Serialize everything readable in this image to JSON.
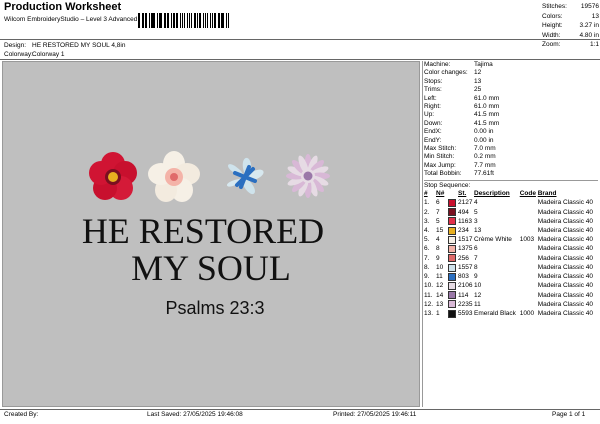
{
  "header": {
    "title": "Production Worksheet",
    "subtitle": "Wilcom EmbroideryStudio – Level 3 Advanced",
    "design_label": "Design:",
    "design_value": "HE RESTORED MY SOUL 4,8in",
    "colorway_label": "Colorway:",
    "colorway_value": "Colorway 1"
  },
  "summary": [
    {
      "k": "Stitches:",
      "v": "19576"
    },
    {
      "k": "Colors:",
      "v": "13"
    },
    {
      "k": "Height:",
      "v": "3.27 in"
    },
    {
      "k": "Width:",
      "v": "4.80 in"
    },
    {
      "k": "Zoom:",
      "v": "1:1"
    }
  ],
  "params": [
    {
      "k": "Machine:",
      "v": "Tajima"
    },
    {
      "k": "Color changes:",
      "v": "12"
    },
    {
      "k": "Stops:",
      "v": "13"
    },
    {
      "k": "Trims:",
      "v": "25"
    },
    {
      "k": "Left:",
      "v": "61.0 mm"
    },
    {
      "k": "Right:",
      "v": "61.0 mm"
    },
    {
      "k": "Up:",
      "v": "41.5 mm"
    },
    {
      "k": "Down:",
      "v": "41.5 mm"
    },
    {
      "k": "EndX:",
      "v": "0.00 in"
    },
    {
      "k": "EndY:",
      "v": "0.00 in"
    },
    {
      "k": "Max Stitch:",
      "v": "7.0 mm"
    },
    {
      "k": "Min Stitch:",
      "v": "0.2 mm"
    },
    {
      "k": "Max Jump:",
      "v": "7.7 mm"
    },
    {
      "k": "Total Bobbin:",
      "v": "77.61ft"
    }
  ],
  "sequence": {
    "heading": "Stop Sequence:",
    "columns": [
      "#",
      "N#",
      "St.",
      "Description",
      "Code",
      "Brand"
    ],
    "rows": [
      {
        "n": "1.",
        "needle": "6",
        "color": "#c8102e",
        "code": "2127",
        "desc": "4",
        "ccode": "",
        "brand": "Madeira Classic 40"
      },
      {
        "n": "2.",
        "needle": "7",
        "color": "#7a1020",
        "code": "494",
        "desc": "5",
        "ccode": "",
        "brand": "Madeira Classic 40"
      },
      {
        "n": "3.",
        "needle": "5",
        "color": "#e0304a",
        "code": "1163",
        "desc": "3",
        "ccode": "",
        "brand": "Madeira Classic 40"
      },
      {
        "n": "4.",
        "needle": "15",
        "color": "#e8b020",
        "code": "234",
        "desc": "13",
        "ccode": "",
        "brand": "Madeira Classic 40"
      },
      {
        "n": "5.",
        "needle": "4",
        "color": "#f6f0e6",
        "code": "1517",
        "desc": "Crème White",
        "ccode": "1003",
        "brand": "Madeira Classic 40"
      },
      {
        "n": "6.",
        "needle": "8",
        "color": "#f4b3a8",
        "code": "1375",
        "desc": "6",
        "ccode": "",
        "brand": "Madeira Classic 40"
      },
      {
        "n": "7.",
        "needle": "9",
        "color": "#e06a6a",
        "code": "256",
        "desc": "7",
        "ccode": "",
        "brand": "Madeira Classic 40"
      },
      {
        "n": "8.",
        "needle": "10",
        "color": "#cfe3ec",
        "code": "1557",
        "desc": "8",
        "ccode": "",
        "brand": "Madeira Classic 40"
      },
      {
        "n": "9.",
        "needle": "11",
        "color": "#2b6fc0",
        "code": "803",
        "desc": "9",
        "ccode": "",
        "brand": "Madeira Classic 40"
      },
      {
        "n": "10.",
        "needle": "12",
        "color": "#e6dbe4",
        "code": "2106",
        "desc": "10",
        "ccode": "",
        "brand": "Madeira Classic 40"
      },
      {
        "n": "11.",
        "needle": "14",
        "color": "#9a78a8",
        "code": "114",
        "desc": "12",
        "ccode": "",
        "brand": "Madeira Classic 40"
      },
      {
        "n": "12.",
        "needle": "13",
        "color": "#d8b8d6",
        "code": "2235",
        "desc": "11",
        "ccode": "",
        "brand": "Madeira Classic 40"
      },
      {
        "n": "13.",
        "needle": "1",
        "color": "#111111",
        "code": "5593",
        "desc": "Emerald Black",
        "ccode": "1000",
        "brand": "Madeira Classic 40"
      }
    ]
  },
  "artwork": {
    "line1": "HE RESTORED",
    "line2": "MY SOUL",
    "line3": "Psalms 23:3"
  },
  "footer": {
    "created": "Created By:",
    "saved": "Last Saved: 27/05/2025 19:46:08",
    "printed": "Printed: 27/05/2025 19:46:11",
    "page": "Page 1 of 1"
  }
}
